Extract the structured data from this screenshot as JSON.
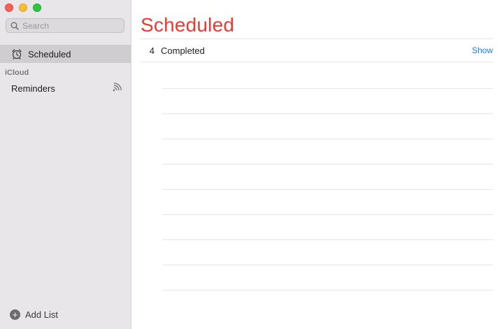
{
  "sidebar": {
    "search": {
      "placeholder": "Search",
      "value": ""
    },
    "smart_list": {
      "label": "Scheduled",
      "icon": "alarm-clock-icon"
    },
    "section_header": "iCloud",
    "lists": [
      {
        "label": "Reminders",
        "icon": "shared-broadcast-icon"
      }
    ],
    "add_list_label": "Add List"
  },
  "main": {
    "title": "Scheduled",
    "title_color": "#f0392f",
    "completed": {
      "count": "4",
      "label": "Completed",
      "action": "Show"
    }
  }
}
